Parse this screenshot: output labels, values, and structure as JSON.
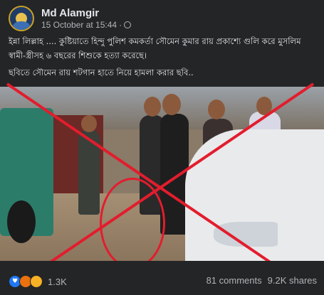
{
  "post": {
    "author": "Md Alamgir",
    "timestamp": "15 October at 15:44",
    "separator": "·",
    "privacy_icon": "globe-icon",
    "caption_lines": [
      "ইন্না লিল্লাহ .... কুষ্টিয়াতে হিন্দু পুলিশ কমকর্তা সৌমেন কুমার রায় প্রকাশ্যে গুলি করে মুসলিম স্বামী-স্ত্রীসহ ৬ বছরের শিশুকে হত্যা করেছে।",
      "ছবিতে সৌমেন রায় শটগান হাতে নিয়ে হামলা করার ছবি.."
    ]
  },
  "reactions": {
    "icons": [
      "love-icon",
      "angry-icon",
      "sad-icon"
    ],
    "count": "1.3K"
  },
  "stats": {
    "comments": "81 comments",
    "shares": "9.2K shares"
  },
  "colors": {
    "background": "#242526",
    "text": "#e4e6eb",
    "muted": "#b0b3b8",
    "overlay_red": "#e21d2d"
  }
}
